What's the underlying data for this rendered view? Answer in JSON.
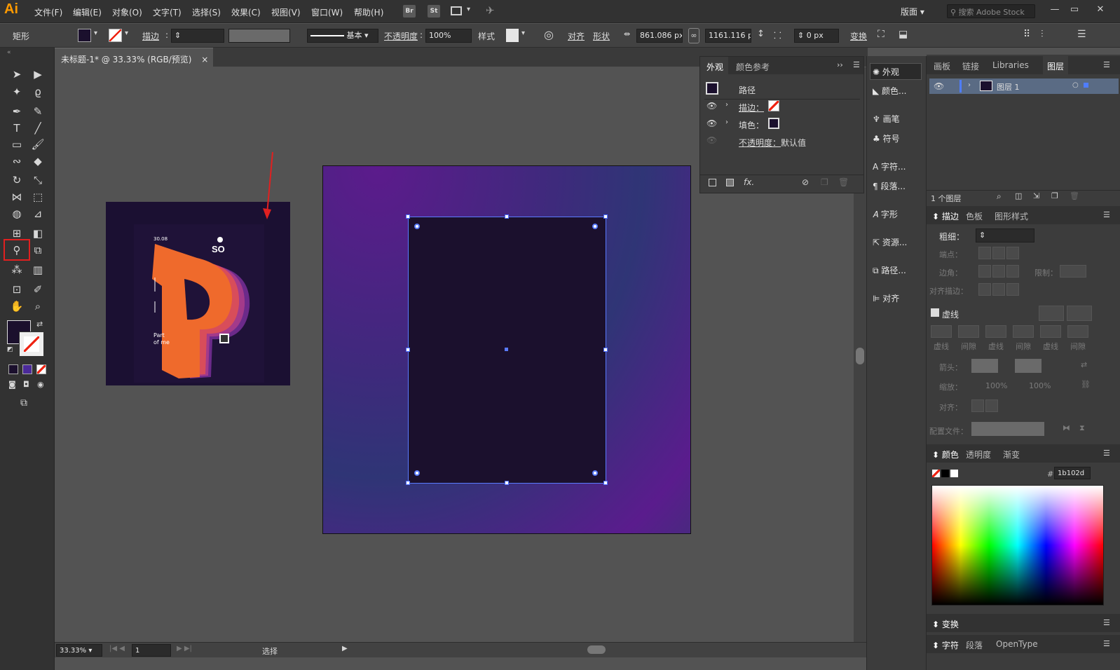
{
  "app": {
    "logo": "Ai"
  },
  "menu": [
    "文件(F)",
    "编辑(E)",
    "对象(O)",
    "文字(T)",
    "选择(S)",
    "效果(C)",
    "视图(V)",
    "窗口(W)",
    "帮助(H)"
  ],
  "toolbar_icons": {
    "bridge": "Br",
    "stock": "St"
  },
  "workspace": "版面",
  "search_placeholder": "搜索 Adobe Stock",
  "control": {
    "object_type": "矩形",
    "stroke_label": "描边",
    "stroke_style": "基本",
    "opacity_label": "不透明度",
    "opacity_value": "100%",
    "style_label": "样式",
    "align_label": "对齐",
    "shape_label": "形状",
    "width_value": "861.086 px",
    "height_value": "1161.116 px",
    "corner_value": "0 px",
    "transform_label": "变换",
    "fill_color": "#1b102d"
  },
  "document_tab": {
    "title": "未标题-1* @ 33.33% (RGB/预览)",
    "close": "×"
  },
  "poster": {
    "date": "30.08",
    "logo": "SO",
    "caption1": "Part",
    "caption2": "of me",
    "letter": "P"
  },
  "status": {
    "zoom": "33.33%",
    "page": "1",
    "tool": "选择"
  },
  "appearance": {
    "tabs": [
      "外观",
      "颜色参考"
    ],
    "title": "路径",
    "stroke_label": "描边：",
    "fill_label": "填色：",
    "opacity_label": "不透明度：",
    "opacity_value": "默认值",
    "fx": "fx."
  },
  "icon_panel": [
    "外观",
    "颜色...",
    "画笔",
    "符号",
    "字符...",
    "段落...",
    "字形",
    "资源...",
    "路径...",
    "对齐"
  ],
  "layers_panel": {
    "tabs": [
      "画板",
      "链接",
      "Libraries",
      "图层"
    ],
    "layer_name": "图层 1",
    "count": "1 个图层"
  },
  "stroke_panel": {
    "tabs": [
      "描边",
      "色板",
      "图形样式"
    ],
    "weight_label": "粗细：",
    "cap_label": "端点：",
    "corner_label": "边角：",
    "limit_label": "限制：",
    "align_label": "对齐描边：",
    "dashed_label": "虚线",
    "dash_labels": [
      "虚线",
      "间隙",
      "虚线",
      "间隙",
      "虚线",
      "间隙"
    ],
    "arrow_label": "箭头：",
    "scale_label": "缩放：",
    "scale1": "100%",
    "scale2": "100%",
    "align2_label": "对齐：",
    "profile_label": "配置文件："
  },
  "color_panel": {
    "tabs": [
      "颜色",
      "透明度",
      "渐变"
    ],
    "hex": "1b102d"
  },
  "bottom_panels": {
    "transform": "变换",
    "char_tabs": [
      "字符",
      "段落",
      "OpenType"
    ]
  }
}
